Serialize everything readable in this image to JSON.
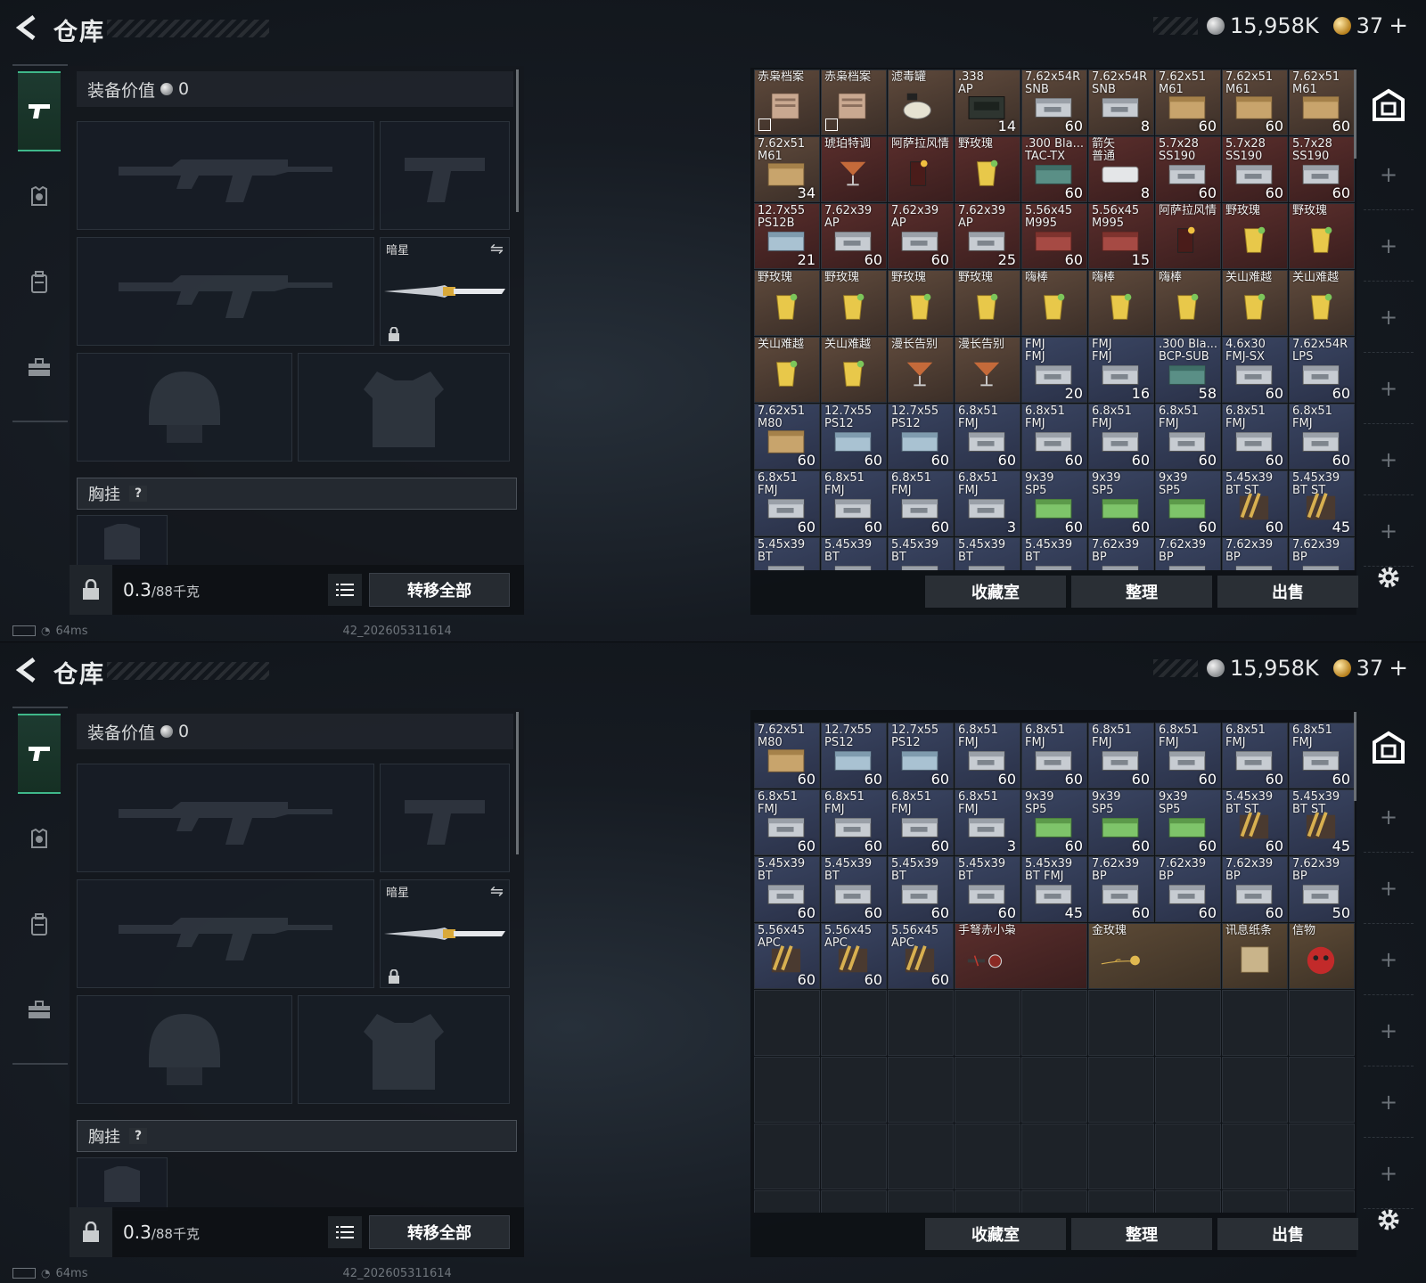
{
  "screens": [
    {
      "header": {
        "title": "仓库",
        "silver": "15,958K",
        "gold": "37",
        "gold_plus": "+"
      },
      "equip": {
        "value_label": "装备价值",
        "value": "0",
        "knife_name": "暗星",
        "chest_label": "胸挂",
        "help": "?",
        "weight": "0.3",
        "weight_unit": "/88千克",
        "transfer_all": "转移全部"
      },
      "status": {
        "ping": "64ms",
        "build": "42_202605311614"
      },
      "stash_buttons": [
        "收藏室",
        "整理",
        "出售"
      ]
    },
    {
      "header": {
        "title": "仓库",
        "silver": "15,958K",
        "gold": "37",
        "gold_plus": "+"
      },
      "equip": {
        "value_label": "装备价值",
        "value": "0",
        "knife_name": "暗星",
        "chest_label": "胸挂",
        "help": "?",
        "weight": "0.3",
        "weight_unit": "/88千克",
        "transfer_all": "转移全部"
      },
      "status": {
        "ping": "64ms",
        "build": "42_202605311614"
      },
      "stash_buttons": [
        "收藏室",
        "整理",
        "出售"
      ]
    }
  ],
  "grid_top": [
    {
      "n": "赤枭档案",
      "c": "",
      "t": "brown",
      "a": "doc",
      "x": true
    },
    {
      "n": "赤枭档案",
      "c": "",
      "t": "brown",
      "a": "doc",
      "x": true
    },
    {
      "n": "滤毒罐",
      "c": "",
      "t": "brown",
      "a": "can"
    },
    {
      "n": ".338\nAP",
      "c": "14",
      "t": "brown",
      "a": "crate"
    },
    {
      "n": "7.62x54R\nSNB",
      "c": "60",
      "t": "brown",
      "a": "box"
    },
    {
      "n": "7.62x54R\nSNB",
      "c": "8",
      "t": "brown",
      "a": "box"
    },
    {
      "n": "7.62x51\nM61",
      "c": "60",
      "t": "brown",
      "a": "boxy"
    },
    {
      "n": "7.62x51\nM61",
      "c": "60",
      "t": "brown",
      "a": "boxy"
    },
    {
      "n": "7.62x51\nM61",
      "c": "60",
      "t": "brown",
      "a": "boxy"
    },
    {
      "n": "7.62x51\nM61",
      "c": "34",
      "t": "brown",
      "a": "boxy"
    },
    {
      "n": "琥珀特调",
      "c": "",
      "t": "red",
      "a": "cock"
    },
    {
      "n": "阿萨拉风情",
      "c": "",
      "t": "red",
      "a": "cola"
    },
    {
      "n": "野玫瑰",
      "c": "",
      "t": "red",
      "a": "drink"
    },
    {
      "n": ".300 Bla...\nTAC-TX",
      "c": "60",
      "t": "red",
      "a": "boxt"
    },
    {
      "n": "箭矢\n普通",
      "c": "8",
      "t": "red",
      "a": "boxw"
    },
    {
      "n": "5.7x28\nSS190",
      "c": "60",
      "t": "red",
      "a": "box"
    },
    {
      "n": "5.7x28\nSS190",
      "c": "60",
      "t": "red",
      "a": "box"
    },
    {
      "n": "5.7x28\nSS190",
      "c": "60",
      "t": "red",
      "a": "box"
    },
    {
      "n": "12.7x55\nPS12B",
      "c": "21",
      "t": "red",
      "a": "boxb"
    },
    {
      "n": "7.62x39\nAP",
      "c": "60",
      "t": "red",
      "a": "box"
    },
    {
      "n": "7.62x39\nAP",
      "c": "60",
      "t": "red",
      "a": "box"
    },
    {
      "n": "7.62x39\nAP",
      "c": "25",
      "t": "red",
      "a": "box"
    },
    {
      "n": "5.56x45\nM995",
      "c": "60",
      "t": "red",
      "a": "boxr"
    },
    {
      "n": "5.56x45\nM995",
      "c": "15",
      "t": "red",
      "a": "boxr"
    },
    {
      "n": "阿萨拉风情",
      "c": "",
      "t": "red",
      "a": "cola"
    },
    {
      "n": "野玫瑰",
      "c": "",
      "t": "red",
      "a": "drink"
    },
    {
      "n": "野玫瑰",
      "c": "",
      "t": "red",
      "a": "drink"
    },
    {
      "n": "野玫瑰",
      "c": "",
      "t": "brown",
      "a": "drink"
    },
    {
      "n": "野玫瑰",
      "c": "",
      "t": "brown",
      "a": "drink"
    },
    {
      "n": "野玫瑰",
      "c": "",
      "t": "brown",
      "a": "drink"
    },
    {
      "n": "野玫瑰",
      "c": "",
      "t": "brown",
      "a": "drink"
    },
    {
      "n": "嗨棒",
      "c": "",
      "t": "brown",
      "a": "drink"
    },
    {
      "n": "嗨棒",
      "c": "",
      "t": "brown",
      "a": "drink"
    },
    {
      "n": "嗨棒",
      "c": "",
      "t": "brown",
      "a": "drink"
    },
    {
      "n": "关山难越",
      "c": "",
      "t": "brown",
      "a": "drink"
    },
    {
      "n": "关山难越",
      "c": "",
      "t": "brown",
      "a": "drink"
    },
    {
      "n": "关山难越",
      "c": "",
      "t": "brown",
      "a": "drink"
    },
    {
      "n": "关山难越",
      "c": "",
      "t": "brown",
      "a": "drink"
    },
    {
      "n": "漫长告别",
      "c": "",
      "t": "brown",
      "a": "cock"
    },
    {
      "n": "漫长告别",
      "c": "",
      "t": "brown",
      "a": "cock"
    },
    {
      "n": "FMJ\nFMJ",
      "c": "20",
      "t": "blue",
      "a": "box"
    },
    {
      "n": "FMJ\nFMJ",
      "c": "16",
      "t": "blue",
      "a": "box"
    },
    {
      "n": ".300 Bla...\nBCP-SUB",
      "c": "58",
      "t": "blue",
      "a": "boxt"
    },
    {
      "n": "4.6x30\nFMJ-SX",
      "c": "60",
      "t": "blue",
      "a": "box"
    },
    {
      "n": "7.62x54R\nLPS",
      "c": "60",
      "t": "blue",
      "a": "box"
    },
    {
      "n": "7.62x51\nM80",
      "c": "60",
      "t": "blue",
      "a": "boxy"
    },
    {
      "n": "12.7x55\nPS12",
      "c": "60",
      "t": "blue",
      "a": "boxb"
    },
    {
      "n": "12.7x55\nPS12",
      "c": "60",
      "t": "blue",
      "a": "boxb"
    },
    {
      "n": "6.8x51\nFMJ",
      "c": "60",
      "t": "blue",
      "a": "box"
    },
    {
      "n": "6.8x51\nFMJ",
      "c": "60",
      "t": "blue",
      "a": "box"
    },
    {
      "n": "6.8x51\nFMJ",
      "c": "60",
      "t": "blue",
      "a": "box"
    },
    {
      "n": "6.8x51\nFMJ",
      "c": "60",
      "t": "blue",
      "a": "box"
    },
    {
      "n": "6.8x51\nFMJ",
      "c": "60",
      "t": "blue",
      "a": "box"
    },
    {
      "n": "6.8x51\nFMJ",
      "c": "60",
      "t": "blue",
      "a": "box"
    },
    {
      "n": "6.8x51\nFMJ",
      "c": "60",
      "t": "blue",
      "a": "box"
    },
    {
      "n": "6.8x51\nFMJ",
      "c": "60",
      "t": "blue",
      "a": "box"
    },
    {
      "n": "6.8x51\nFMJ",
      "c": "60",
      "t": "blue",
      "a": "box"
    },
    {
      "n": "6.8x51\nFMJ",
      "c": "3",
      "t": "blue",
      "a": "box"
    },
    {
      "n": "9x39\nSP5",
      "c": "60",
      "t": "blue",
      "a": "boxg"
    },
    {
      "n": "9x39\nSP5",
      "c": "60",
      "t": "blue",
      "a": "boxg"
    },
    {
      "n": "9x39\nSP5",
      "c": "60",
      "t": "blue",
      "a": "boxg"
    },
    {
      "n": "5.45x39\nBT ST",
      "c": "60",
      "t": "blue",
      "a": "ammo"
    },
    {
      "n": "5.45x39\nBT ST",
      "c": "45",
      "t": "blue",
      "a": "ammo"
    },
    {
      "n": "5.45x39\nBT",
      "c": "",
      "t": "blue",
      "a": "box"
    },
    {
      "n": "5.45x39\nBT",
      "c": "",
      "t": "blue",
      "a": "box"
    },
    {
      "n": "5.45x39\nBT",
      "c": "",
      "t": "blue",
      "a": "box"
    },
    {
      "n": "5.45x39\nBT",
      "c": "",
      "t": "blue",
      "a": "box"
    },
    {
      "n": "5.45x39\nBT",
      "c": "",
      "t": "blue",
      "a": "box"
    },
    {
      "n": "7.62x39\nBP",
      "c": "",
      "t": "blue",
      "a": "box"
    },
    {
      "n": "7.62x39\nBP",
      "c": "",
      "t": "blue",
      "a": "box"
    },
    {
      "n": "7.62x39\nBP",
      "c": "",
      "t": "blue",
      "a": "box"
    },
    {
      "n": "7.62x39\nBP",
      "c": "",
      "t": "blue",
      "a": "box"
    }
  ],
  "grid_bottom": [
    {
      "n": "7.62x51\nM80",
      "c": "60",
      "t": "blue",
      "a": "boxy"
    },
    {
      "n": "12.7x55\nPS12",
      "c": "60",
      "t": "blue",
      "a": "boxb"
    },
    {
      "n": "12.7x55\nPS12",
      "c": "60",
      "t": "blue",
      "a": "boxb"
    },
    {
      "n": "6.8x51\nFMJ",
      "c": "60",
      "t": "blue",
      "a": "box"
    },
    {
      "n": "6.8x51\nFMJ",
      "c": "60",
      "t": "blue",
      "a": "box"
    },
    {
      "n": "6.8x51\nFMJ",
      "c": "60",
      "t": "blue",
      "a": "box"
    },
    {
      "n": "6.8x51\nFMJ",
      "c": "60",
      "t": "blue",
      "a": "box"
    },
    {
      "n": "6.8x51\nFMJ",
      "c": "60",
      "t": "blue",
      "a": "box"
    },
    {
      "n": "6.8x51\nFMJ",
      "c": "60",
      "t": "blue",
      "a": "box"
    },
    {
      "n": "6.8x51\nFMJ",
      "c": "60",
      "t": "blue",
      "a": "box"
    },
    {
      "n": "6.8x51\nFMJ",
      "c": "60",
      "t": "blue",
      "a": "box"
    },
    {
      "n": "6.8x51\nFMJ",
      "c": "60",
      "t": "blue",
      "a": "box"
    },
    {
      "n": "6.8x51\nFMJ",
      "c": "3",
      "t": "blue",
      "a": "box"
    },
    {
      "n": "9x39\nSP5",
      "c": "60",
      "t": "blue",
      "a": "boxg"
    },
    {
      "n": "9x39\nSP5",
      "c": "60",
      "t": "blue",
      "a": "boxg"
    },
    {
      "n": "9x39\nSP5",
      "c": "60",
      "t": "blue",
      "a": "boxg"
    },
    {
      "n": "5.45x39\nBT ST",
      "c": "60",
      "t": "blue",
      "a": "ammo"
    },
    {
      "n": "5.45x39\nBT ST",
      "c": "45",
      "t": "blue",
      "a": "ammo"
    },
    {
      "n": "5.45x39\nBT",
      "c": "60",
      "t": "blue",
      "a": "box"
    },
    {
      "n": "5.45x39\nBT",
      "c": "60",
      "t": "blue",
      "a": "box"
    },
    {
      "n": "5.45x39\nBT",
      "c": "60",
      "t": "blue",
      "a": "box"
    },
    {
      "n": "5.45x39\nBT",
      "c": "60",
      "t": "blue",
      "a": "box"
    },
    {
      "n": "5.45x39\nBT FMJ",
      "c": "45",
      "t": "blue",
      "a": "box"
    },
    {
      "n": "7.62x39\nBP",
      "c": "60",
      "t": "blue",
      "a": "box"
    },
    {
      "n": "7.62x39\nBP",
      "c": "60",
      "t": "blue",
      "a": "box"
    },
    {
      "n": "7.62x39\nBP",
      "c": "60",
      "t": "blue",
      "a": "box"
    },
    {
      "n": "7.62x39\nBP",
      "c": "50",
      "t": "blue",
      "a": "box"
    },
    {
      "n": "5.56x45\nAPC",
      "c": "60",
      "t": "blue",
      "a": "ammo"
    },
    {
      "n": "5.56x45\nAPC",
      "c": "60",
      "t": "blue",
      "a": "ammo"
    },
    {
      "n": "5.56x45\nAPC",
      "c": "60",
      "t": "blue",
      "a": "ammo"
    },
    {
      "n": "手弩赤小枭",
      "c": "",
      "t": "red",
      "a": "xbow",
      "w": 2
    },
    {
      "n": "金玫瑰",
      "c": "",
      "t": "gold",
      "a": "rose",
      "w": 2
    },
    {
      "n": "讯息纸条",
      "c": "",
      "t": "gold",
      "a": "paper"
    },
    {
      "n": "信物",
      "c": "",
      "t": "gold",
      "a": "mask"
    }
  ],
  "colors": {
    "accent_green": "#3fb88a",
    "rarity_brown": "#5f4a3c",
    "rarity_red": "#5a2e2c",
    "rarity_blue": "#3a4562",
    "rarity_gold": "#5c4a36"
  }
}
